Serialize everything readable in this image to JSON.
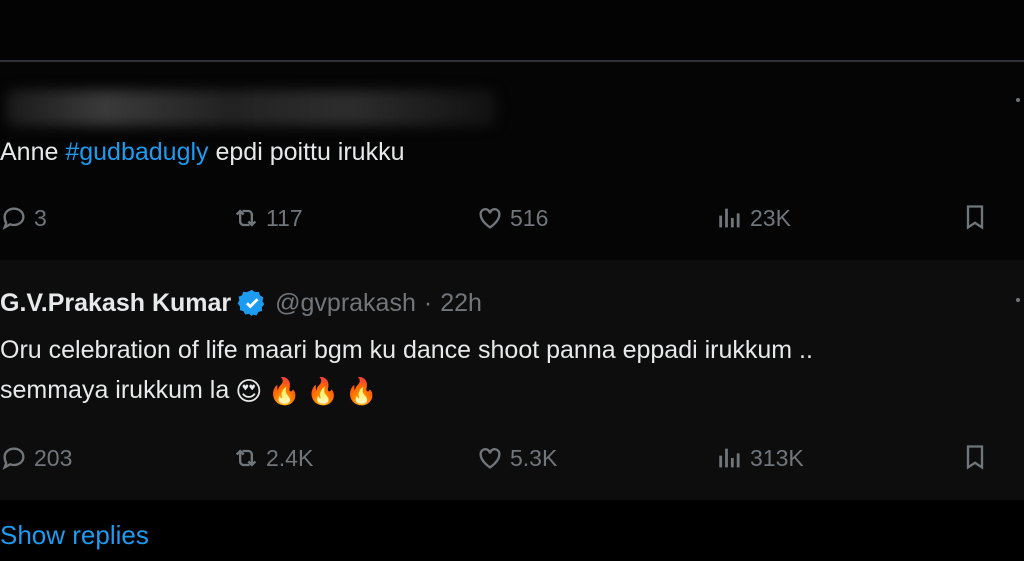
{
  "tweet1": {
    "text_before": "Anne ",
    "hashtag": "#gudbadugly",
    "text_after": " epdi poittu irukku",
    "replies": "3",
    "retweets": "117",
    "likes": "516",
    "views": "23K"
  },
  "tweet2": {
    "name": "G.V.Prakash Kumar",
    "handle": "@gvprakash",
    "separator": "·",
    "time": "22h",
    "line1": "Oru celebration of life maari bgm ku dance shoot panna eppadi irukkum ..",
    "line2": "semmaya irukkum la",
    "emojis": [
      "😍",
      "🔥",
      "🔥",
      "🔥"
    ],
    "replies": "203",
    "retweets": "2.4K",
    "likes": "5.3K",
    "views": "313K"
  },
  "show_replies": "Show replies",
  "colors": {
    "accent": "#1d9bf0",
    "muted": "#71767b",
    "text": "#e7e9ea"
  },
  "icons": [
    "reply-icon",
    "retweet-icon",
    "like-icon",
    "views-icon",
    "bookmark-icon",
    "verified-badge-icon",
    "more-icon"
  ]
}
